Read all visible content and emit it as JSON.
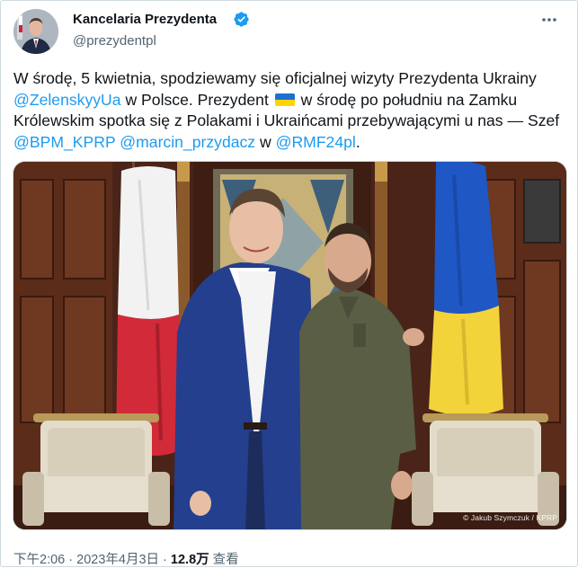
{
  "account": {
    "display_name": "Kancelaria Prezydenta",
    "handle": "@prezydentpl",
    "verified_icon": "verified-badge",
    "more_icon": "more-horizontal"
  },
  "tweet": {
    "part1": "W środę, 5 kwietnia, spodziewamy się oficjalnej wizyty Prezydenta Ukrainy ",
    "mention1": "@ZelenskyyUa",
    "part2": " w Polsce. Prezydent ",
    "flag_emoji": "ukraine-flag",
    "part3": " w środę po południu na Zamku Królewskim spotka się z Polakami i Ukraińcami przebywającymi u nas  — Szef ",
    "mention2": "@BPM_KPRP",
    "part4": " ",
    "mention3": "@marcin_przydacz",
    "part5": " w ",
    "mention4": "@RMF24pl",
    "part6": "."
  },
  "photo": {
    "credit": "© Jakub Szymczuk / KPRP"
  },
  "meta": {
    "time": "下午2:06",
    "sep1": " · ",
    "date": "2023年4月3日",
    "sep2": " · ",
    "views": "12.8万",
    "views_label": " 查看"
  },
  "colors": {
    "link": "#1d9bf0",
    "text": "#0f1419",
    "secondary": "#536471",
    "verified": "#1d9bf0"
  }
}
